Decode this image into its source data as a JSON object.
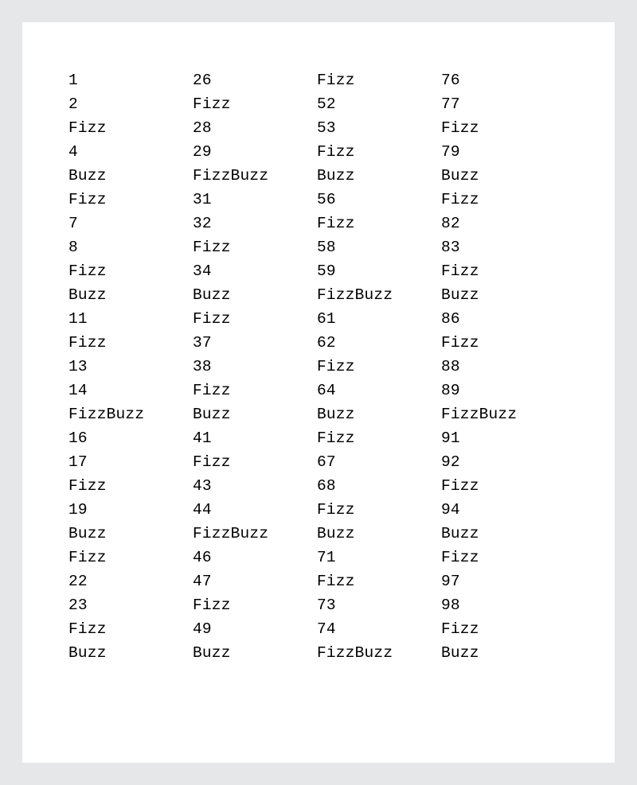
{
  "columns": [
    [
      "1",
      "2",
      "Fizz",
      "4",
      "Buzz",
      "Fizz",
      "7",
      "8",
      "Fizz",
      "Buzz",
      "11",
      "Fizz",
      "13",
      "14",
      "FizzBuzz",
      "16",
      "17",
      "Fizz",
      "19",
      "Buzz",
      "Fizz",
      "22",
      "23",
      "Fizz",
      "Buzz"
    ],
    [
      "26",
      "Fizz",
      "28",
      "29",
      "FizzBuzz",
      "31",
      "32",
      "Fizz",
      "34",
      "Buzz",
      "Fizz",
      "37",
      "38",
      "Fizz",
      "Buzz",
      "41",
      "Fizz",
      "43",
      "44",
      "FizzBuzz",
      "46",
      "47",
      "Fizz",
      "49",
      "Buzz"
    ],
    [
      "Fizz",
      "52",
      "53",
      "Fizz",
      "Buzz",
      "56",
      "Fizz",
      "58",
      "59",
      "FizzBuzz",
      "61",
      "62",
      "Fizz",
      "64",
      "Buzz",
      "Fizz",
      "67",
      "68",
      "Fizz",
      "Buzz",
      "71",
      "Fizz",
      "73",
      "74",
      "FizzBuzz"
    ],
    [
      "76",
      "77",
      "Fizz",
      "79",
      "Buzz",
      "Fizz",
      "82",
      "83",
      "Fizz",
      "Buzz",
      "86",
      "Fizz",
      "88",
      "89",
      "FizzBuzz",
      "91",
      "92",
      "Fizz",
      "94",
      "Buzz",
      "Fizz",
      "97",
      "98",
      "Fizz",
      "Buzz"
    ]
  ]
}
